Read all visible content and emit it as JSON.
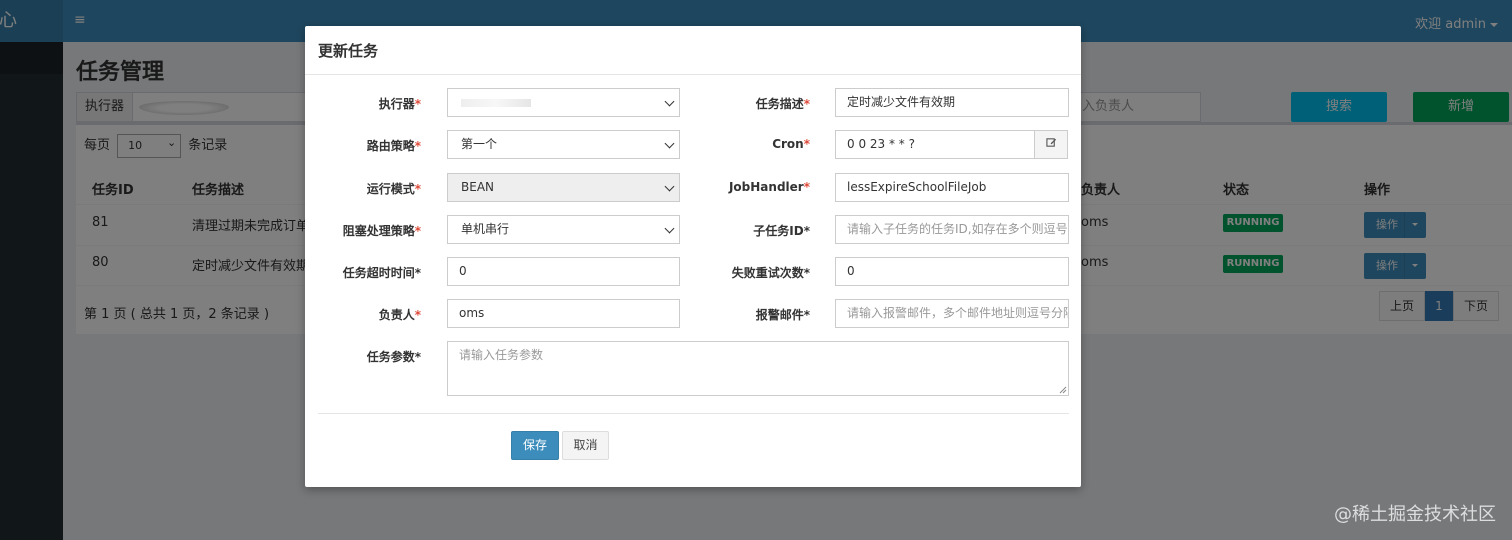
{
  "header": {
    "logo_text": "心",
    "menu_icon": "hamburger-icon",
    "user_menu": "欢迎 admin"
  },
  "page": {
    "title": "任务管理",
    "filter_label": "执行器",
    "owner_placeholder": "入负责人",
    "search_button": "搜索",
    "add_button": "新增"
  },
  "table": {
    "per_page_prefix": "每页",
    "per_page_value": "10",
    "per_page_suffix": "条记录",
    "columns": [
      "任务ID",
      "任务描述",
      "负责人",
      "状态",
      "操作"
    ],
    "rows": [
      {
        "id": "81",
        "desc": "清理过期未完成订单",
        "owner": "oms",
        "status": "RUNNING",
        "op": "操作"
      },
      {
        "id": "80",
        "desc": "定时减少文件有效期",
        "owner": "oms",
        "status": "RUNNING",
        "op": "操作"
      }
    ],
    "pagination_info": "第 1 页 ( 总共 1 页，2 条记录 )",
    "prev": "上页",
    "current": "1",
    "next": "下页"
  },
  "watermark": "@稀土掘金技术社区",
  "modal": {
    "title": "更新任务",
    "fields": {
      "executor": {
        "label": "执行器",
        "required_mark": "*"
      },
      "task_desc": {
        "label": "任务描述",
        "required_mark": "*",
        "value": "定时减少文件有效期"
      },
      "route": {
        "label": "路由策略",
        "required_mark": "*",
        "value": "第一个"
      },
      "cron": {
        "label": "Cron",
        "required_mark": "*",
        "value": "0 0 23 * * ?"
      },
      "run_mode": {
        "label": "运行模式",
        "required_mark": "*",
        "value": "BEAN"
      },
      "job_handler": {
        "label": "JobHandler",
        "required_mark": "*",
        "value": "lessExpireSchoolFileJob"
      },
      "block_strategy": {
        "label": "阻塞处理策略",
        "required_mark": "*",
        "value": "单机串行"
      },
      "child_id": {
        "label": "子任务ID*",
        "placeholder": "请输入子任务的任务ID,如存在多个则逗号分隔"
      },
      "timeout": {
        "label": "任务超时时间*",
        "value": "0"
      },
      "retry": {
        "label": "失败重试次数*",
        "value": "0"
      },
      "owner": {
        "label": "负责人",
        "required_mark": "*",
        "value": "oms"
      },
      "alarm_email": {
        "label": "报警邮件*",
        "placeholder": "请输入报警邮件，多个邮件地址则逗号分隔"
      },
      "params": {
        "label": "任务参数*",
        "placeholder": "请输入任务参数"
      }
    },
    "save_button": "保存",
    "cancel_button": "取消"
  }
}
